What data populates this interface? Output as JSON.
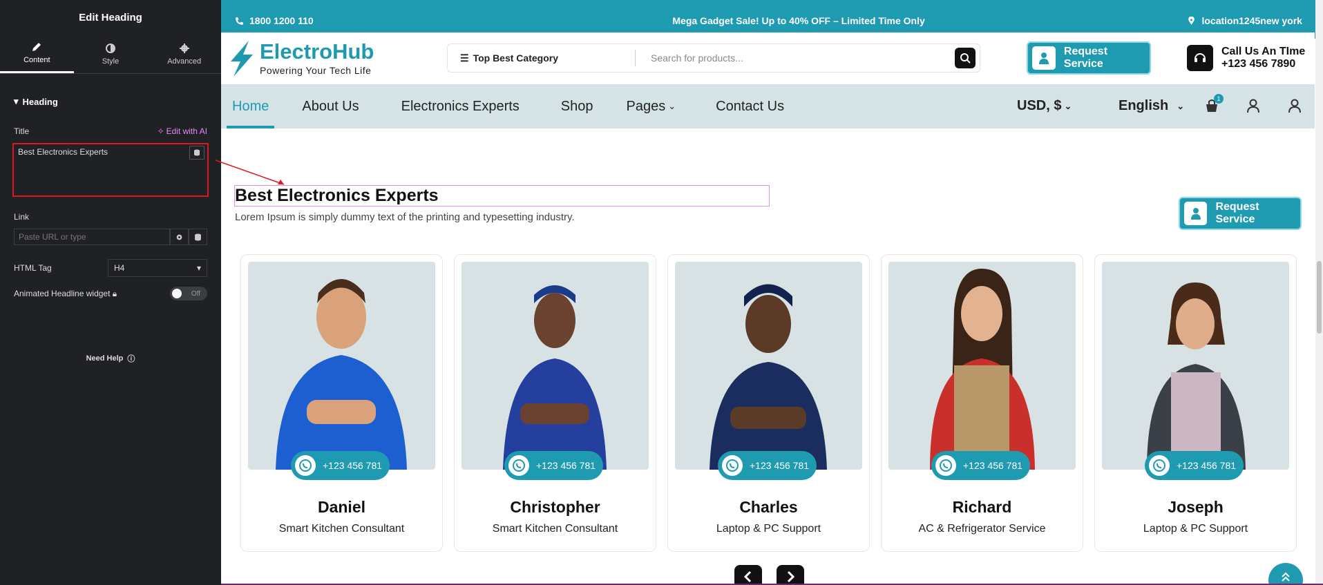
{
  "panel": {
    "title": "Edit Heading",
    "tabs": [
      {
        "label": "Content",
        "icon": "pencil-icon"
      },
      {
        "label": "Style",
        "icon": "contrast-icon"
      },
      {
        "label": "Advanced",
        "icon": "gear-icon"
      }
    ],
    "section": "Heading",
    "title_label": "Title",
    "ai_link": "Edit with AI",
    "title_value": "Best Electronics Experts",
    "link_label": "Link",
    "link_placeholder": "Paste URL or type",
    "html_tag_label": "HTML Tag",
    "html_tag_value": "H4",
    "animated_label": "Animated Headline widget",
    "toggle_label": "Off",
    "help": "Need Help"
  },
  "site": {
    "topbar": {
      "phone": "1800 1200 110",
      "promo": "Mega Gadget Sale! Up to 40% OFF – Limited Time Only",
      "location": "location1245new york"
    },
    "logo": {
      "name": "ElectroHub",
      "tagline": "Powering Your Tech Life"
    },
    "search": {
      "category": "Top Best Category",
      "placeholder": "Search for products..."
    },
    "request_service": "Request Service",
    "call": {
      "line1": "Call Us An TIme",
      "line2": "+123 456 7890"
    },
    "nav": [
      "Home",
      "About Us",
      "Electronics Experts",
      "Shop",
      "Pages",
      "Contact Us"
    ],
    "currency": "USD, $",
    "language": "English",
    "cart_count": "1",
    "heading": "Best Electronics Experts",
    "subheading": "Lorem Ipsum is simply dummy text of the printing and typesetting industry.",
    "experts": [
      {
        "name": "Daniel",
        "role": "Smart Kitchen Consultant",
        "phone": "+123 456 781"
      },
      {
        "name": "Christopher",
        "role": "Smart Kitchen Consultant",
        "phone": "+123 456 781"
      },
      {
        "name": "Charles",
        "role": "Laptop & PC Support",
        "phone": "+123 456 781"
      },
      {
        "name": "Richard",
        "role": "AC & Refrigerator Service",
        "phone": "+123 456 781"
      },
      {
        "name": "Joseph",
        "role": "Laptop & PC Support",
        "phone": "+123 456 781"
      }
    ]
  },
  "colors": {
    "accent": "#1f9bb1",
    "panel_bg": "#1f2124",
    "nav_bg": "#d5e3e6",
    "highlight": "#e0151e"
  }
}
